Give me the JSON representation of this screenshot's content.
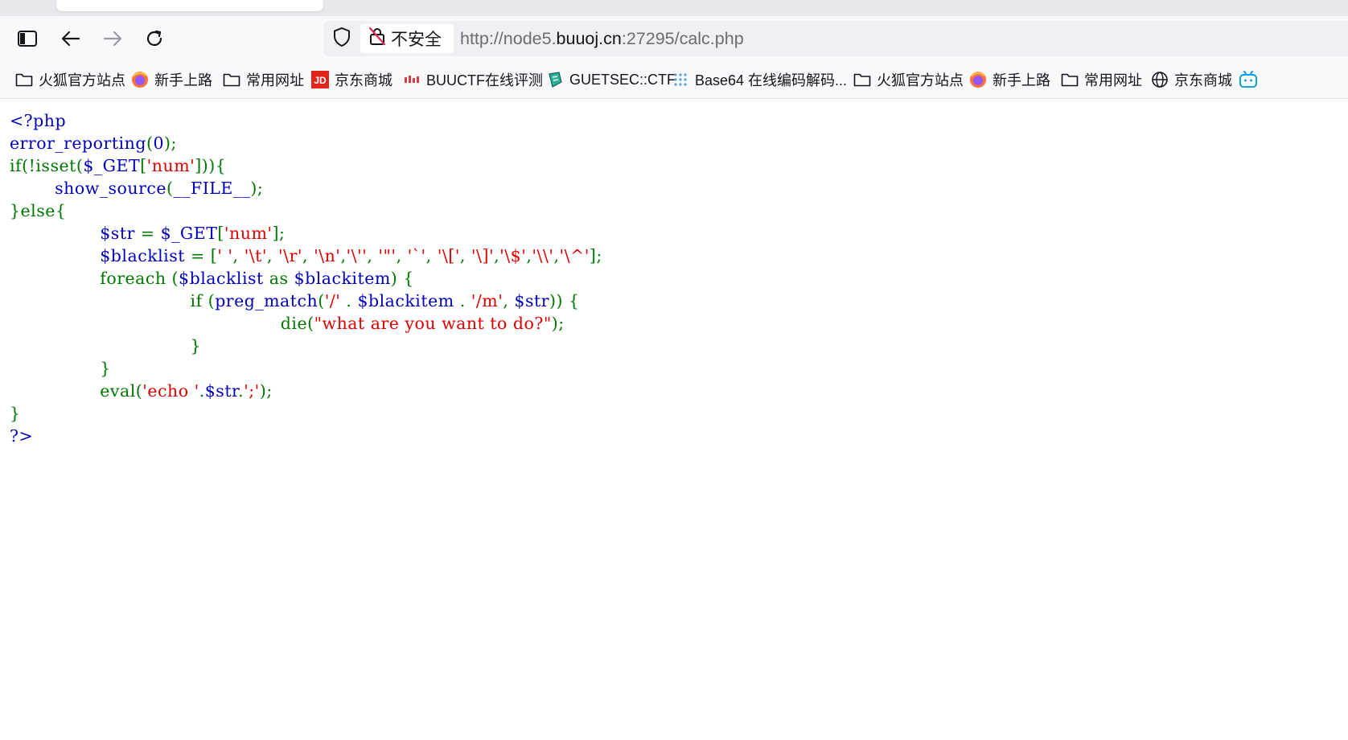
{
  "browser": {
    "url_security_label": "不安全",
    "url": {
      "prefix": "http://node5.",
      "host": "buuoj.cn",
      "suffix": ":27295/calc.php"
    },
    "bookmarks": [
      {
        "label": "火狐官方站点",
        "icon": "folder-icon"
      },
      {
        "label": "新手上路",
        "icon": "firefox-icon"
      },
      {
        "label": "常用网址",
        "icon": "folder-icon"
      },
      {
        "label": "京东商城",
        "icon": "jd-icon"
      },
      {
        "label": "BUUCTF在线评测",
        "icon": "buuctf-icon"
      },
      {
        "label": "GUETSEC::CTF",
        "icon": "guetsec-icon"
      },
      {
        "label": "Base64 在线编码解码...",
        "icon": "base64-icon"
      },
      {
        "label": "火狐官方站点",
        "icon": "folder-icon"
      },
      {
        "label": "新手上路",
        "icon": "firefox-icon"
      },
      {
        "label": "常用网址",
        "icon": "folder-icon"
      },
      {
        "label": "京东商城",
        "icon": "globe-icon"
      }
    ]
  },
  "colors": {
    "php_default": "#0000bb",
    "php_keyword": "#007700",
    "php_string": "#dd0000"
  },
  "source": {
    "l1": "<?php",
    "l2a": "error_reporting",
    "l2b": "(",
    "l2c": "0",
    "l2d": ");",
    "l3a": "if(!isset(",
    "l3b": "$_GET",
    "l3c": "[",
    "l3d": "'num'",
    "l3e": "])){",
    "l4a": "        ",
    "l4b": "show_source",
    "l4c": "(",
    "l4d": "__FILE__",
    "l4e": ");",
    "l5": "}else{",
    "l6a": "                ",
    "l6b": "$str ",
    "l6c": "= ",
    "l6d": "$_GET",
    "l6e": "[",
    "l6f": "'num'",
    "l6g": "];",
    "l7a": "                ",
    "l7b": "$blacklist ",
    "l7c": "= [",
    "l7d": "' '",
    "l7e": ", ",
    "l7f": "'\\t'",
    "l7g": ", ",
    "l7h": "'\\r'",
    "l7i": ", ",
    "l7j": "'\\n'",
    "l7k": ",",
    "l7l": "'\\''",
    "l7m": ", ",
    "l7n": "'\"'",
    "l7o": ", ",
    "l7p": "'`'",
    "l7q": ", ",
    "l7r": "'\\['",
    "l7s": ", ",
    "l7t": "'\\]'",
    "l7u": ",",
    "l7v": "'\\$'",
    "l7w": ",",
    "l7x": "'\\\\'",
    "l7y": ",",
    "l7z": "'\\^'",
    "l7end": "];",
    "l8a": "                foreach (",
    "l8b": "$blacklist ",
    "l8c": "as ",
    "l8d": "$blackitem",
    "l8e": ") {",
    "l9a": "                                if (",
    "l9b": "preg_match",
    "l9c": "(",
    "l9d": "'/' ",
    "l9e": ". ",
    "l9f": "$blackitem ",
    "l9g": ". ",
    "l9h": "'/m'",
    "l9i": ", ",
    "l9j": "$str",
    "l9k": ")) {",
    "l10a": "                                                die(",
    "l10b": "\"what are you want to do?\"",
    "l10c": ");",
    "l11": "                                }",
    "l12": "                }",
    "l13a": "                eval(",
    "l13b": "'echo '",
    "l13c": ".",
    "l13d": "$str",
    "l13e": ".",
    "l13f": "';'",
    "l13g": ");",
    "l14": "}",
    "l15": "?>"
  }
}
